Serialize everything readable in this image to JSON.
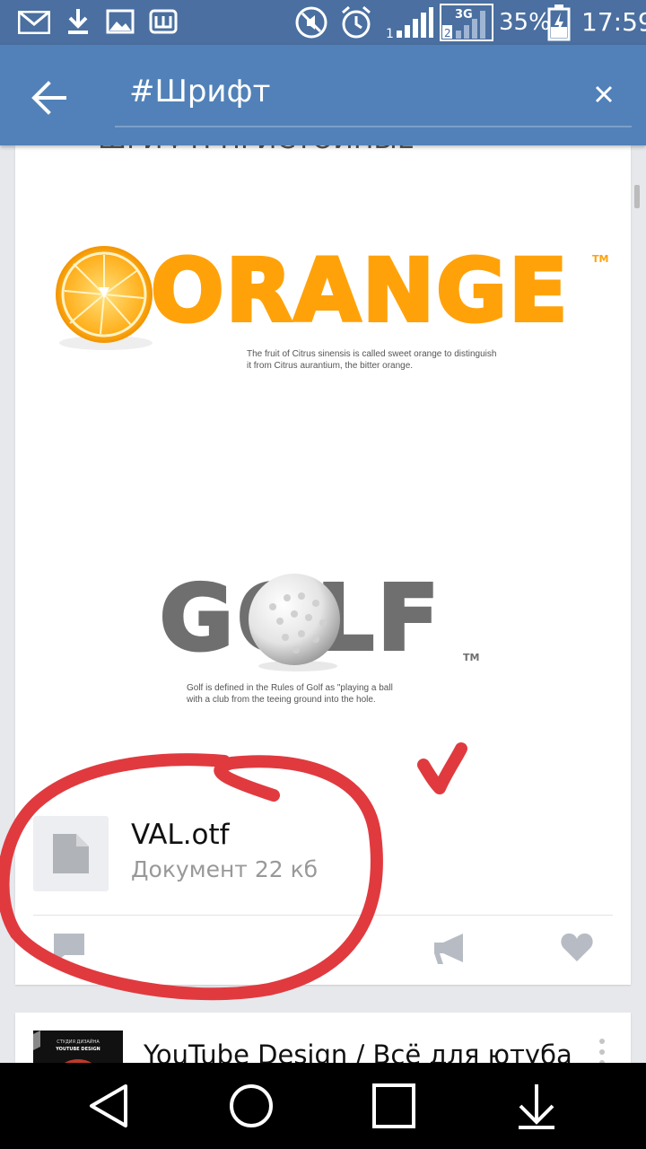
{
  "status_bar": {
    "icons": [
      "mail-icon",
      "download-icon",
      "image-icon",
      "sh-icon",
      "mute-icon",
      "alarm-icon",
      "signal-1-icon",
      "signal-2-icon",
      "battery-icon"
    ],
    "network": "3G",
    "battery": "35%",
    "time": "17:59"
  },
  "header": {
    "back_icon": "arrow-left-icon",
    "query": "#Шрифт",
    "clear_icon": "close-icon",
    "accent": "#5181b8"
  },
  "post1": {
    "cut_text": "ШРИФТ: ПРИСТОЙНЫЕ",
    "poster_orange": {
      "word": "ORANGE",
      "tm": "TM",
      "caption_line1": "The fruit of Citrus sinensis is called sweet orange to distinguish",
      "caption_line2": "it from Citrus aurantium, the bitter orange."
    },
    "poster_golf": {
      "word": "GOLF",
      "tm": "TM",
      "caption_line1": "Golf is defined in the Rules of Golf as \"playing a ball",
      "caption_line2": "with a club from the teeing ground into the hole."
    },
    "attachment": {
      "icon": "document-icon",
      "name": "VAL.otf",
      "meta": "Документ 22 кб"
    },
    "actions": [
      "comment-icon",
      "share-icon",
      "like-icon"
    ]
  },
  "post2": {
    "title": "YouTube Design / Всё для ютуба",
    "thumb_line1": "СТУДИЯ ДИЗАЙНА",
    "thumb_line2": "YOUTUBE DESIGN"
  },
  "nav": [
    "back-triangle-icon",
    "home-circle-icon",
    "recents-square-icon",
    "notifications-down-icon"
  ]
}
